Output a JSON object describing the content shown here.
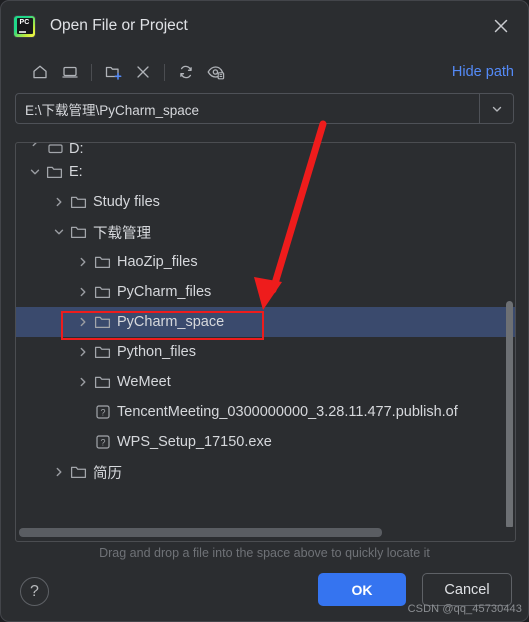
{
  "window": {
    "title": "Open File or Project",
    "app_icon_label": "PC",
    "close_icon": "close-icon"
  },
  "toolbar": {
    "items": [
      {
        "name": "home-icon",
        "tooltip": "Home"
      },
      {
        "name": "desktop-icon",
        "tooltip": "Desktop"
      },
      {
        "name": "new-folder-icon",
        "tooltip": "New Folder"
      },
      {
        "name": "delete-icon",
        "tooltip": "Delete"
      },
      {
        "name": "refresh-icon",
        "tooltip": "Refresh"
      },
      {
        "name": "show-hidden-files-icon",
        "tooltip": "Show Hidden Files and Directories"
      }
    ],
    "hide_path_label": "Hide path"
  },
  "path_field": {
    "value": "E:\\下载管理\\PyCharm_space",
    "placeholder": "",
    "dropdown_icon": "chevron-down-icon"
  },
  "tree": {
    "rows": [
      {
        "label": "D:",
        "indent": 0,
        "twisty": "collapsed",
        "icon": "drive-icon",
        "selected": false,
        "clipped": true
      },
      {
        "label": "E:",
        "indent": 0,
        "twisty": "expanded",
        "icon": "folder-icon",
        "selected": false,
        "clipped": false
      },
      {
        "label": "Study files",
        "indent": 1,
        "twisty": "collapsed",
        "icon": "folder-icon",
        "selected": false,
        "clipped": false
      },
      {
        "label": "下载管理",
        "indent": 1,
        "twisty": "expanded",
        "icon": "folder-icon",
        "selected": false,
        "clipped": false
      },
      {
        "label": "HaoZip_files",
        "indent": 2,
        "twisty": "collapsed",
        "icon": "folder-icon",
        "selected": false,
        "clipped": false
      },
      {
        "label": "PyCharm_files",
        "indent": 2,
        "twisty": "collapsed",
        "icon": "folder-icon",
        "selected": false,
        "clipped": false
      },
      {
        "label": "PyCharm_space",
        "indent": 2,
        "twisty": "collapsed",
        "icon": "folder-icon",
        "selected": true,
        "clipped": false
      },
      {
        "label": "Python_files",
        "indent": 2,
        "twisty": "collapsed",
        "icon": "folder-icon",
        "selected": false,
        "clipped": false
      },
      {
        "label": "WeMeet",
        "indent": 2,
        "twisty": "collapsed",
        "icon": "folder-icon",
        "selected": false,
        "clipped": false
      },
      {
        "label": "TencentMeeting_0300000000_3.28.11.477.publish.of",
        "indent": 2,
        "twisty": "none",
        "icon": "unknown-file-icon",
        "selected": false,
        "clipped": false
      },
      {
        "label": "WPS_Setup_17150.exe",
        "indent": 2,
        "twisty": "none",
        "icon": "unknown-file-icon",
        "selected": false,
        "clipped": false
      },
      {
        "label": "简历",
        "indent": 1,
        "twisty": "collapsed",
        "icon": "folder-icon",
        "selected": false,
        "clipped": false
      }
    ],
    "vertical_scrollbar": "vertical-scrollbar",
    "horizontal_scrollbar": "horizontal-scrollbar"
  },
  "footer": {
    "hint": "Drag and drop a file into the space above to quickly locate it",
    "help_label": "?",
    "ok_label": "OK",
    "cancel_label": "Cancel"
  },
  "annotations": {
    "highlight_box": "red-highlight-box",
    "arrow": "red-arrow",
    "watermark": "CSDN @qq_45730443"
  },
  "colors": {
    "accent": "#3574f0",
    "link": "#548af7",
    "selection": "#3a4a6d",
    "annotation": "#ee1c1c",
    "window_bg": "#2b2d30"
  }
}
